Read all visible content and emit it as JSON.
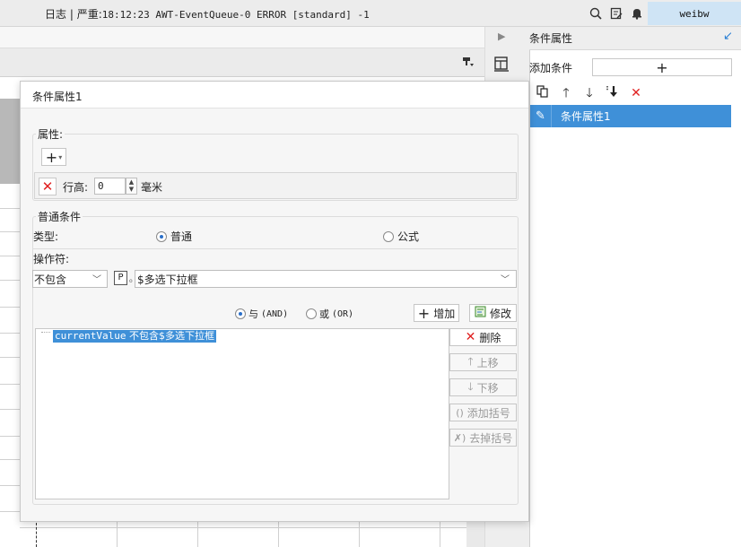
{
  "topbar": {
    "log_label": "日志",
    "separator": "|",
    "severity_label": "严重:",
    "log_message": "18:12:23 AWT-EventQueue-0 ERROR [standard] -1",
    "icons": [
      "search-icon",
      "notes-icon",
      "bell-icon"
    ],
    "user": "weibw"
  },
  "right_panel": {
    "title": "条件属性",
    "add_condition_label": "添加条件",
    "add_button": "+",
    "toolbar_icons": [
      "copy-icon",
      "move-up-icon",
      "move-down-icon",
      "move-bottom-icon",
      "delete-icon"
    ],
    "items": [
      {
        "label": "条件属性1",
        "selected": true
      }
    ]
  },
  "dialog": {
    "title": "条件属性1",
    "attributes": {
      "section_label": "属性:",
      "add_button": "+",
      "row_height_label": "行高:",
      "row_height_value": "0",
      "row_height_unit": "毫米"
    },
    "condition": {
      "section_label": "普通条件",
      "type_label": "类型:",
      "type_options": [
        "普通",
        "公式"
      ],
      "type_selected": "普通",
      "operator_label": "操作符:",
      "operator_value": "不包含",
      "parameter_badge": "P",
      "parameter_sub": "o",
      "value_field": "$多选下拉框",
      "logic_options": [
        {
          "label": "与",
          "code": "(AND)",
          "selected": true
        },
        {
          "label": "或",
          "code": "(OR)",
          "selected": false
        }
      ],
      "add_button": "增加",
      "modify_button": "修改",
      "delete_button": "删除",
      "move_up_button": "上移",
      "move_down_button": "下移",
      "add_paren_button": "添加括号",
      "remove_paren_button": "去掉括号",
      "list_items": [
        {
          "field": "currentValue",
          "text": "不包含$多选下拉框"
        }
      ]
    }
  },
  "colors": {
    "accent": "#3f90d8",
    "delete_red": "#e02020",
    "user_badge_bg": "#cfe4f5"
  }
}
